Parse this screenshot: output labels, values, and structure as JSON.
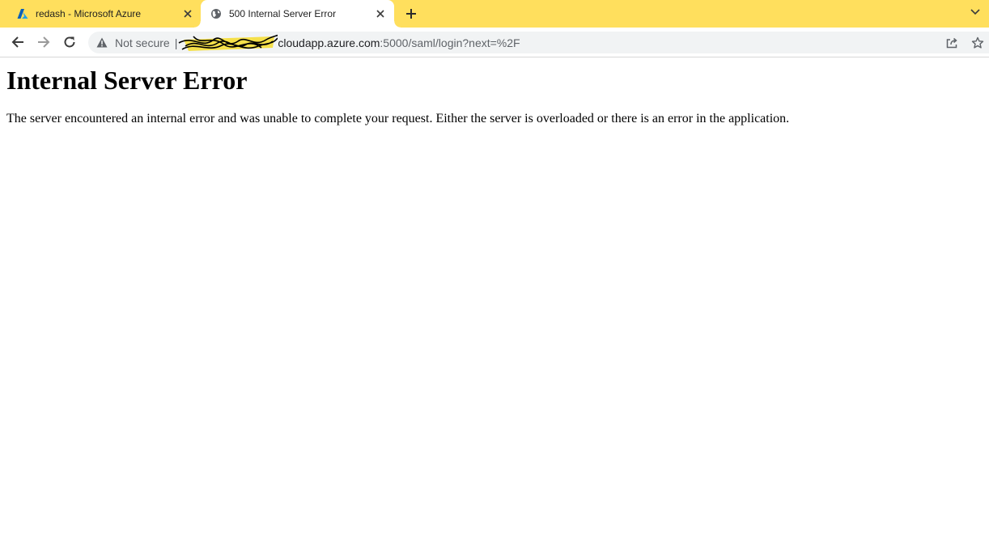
{
  "tabs": [
    {
      "title": "redash - Microsoft Azure",
      "icon": "azure-logo-icon",
      "active": false
    },
    {
      "title": "500 Internal Server Error",
      "icon": "globe-icon",
      "active": true
    }
  ],
  "toolbar": {
    "security_label": "Not secure",
    "url_separator": "|",
    "url_host": "cloudapp.azure.com",
    "url_path": ":5000/saml/login?next=%2F"
  },
  "page": {
    "heading": "Internal Server Error",
    "message": "The server encountered an internal error and was unable to complete your request. Either the server is overloaded or there is an error in the application."
  },
  "colors": {
    "tabstrip": "#ffdf5d",
    "omnibox": "#f1f3f4"
  }
}
